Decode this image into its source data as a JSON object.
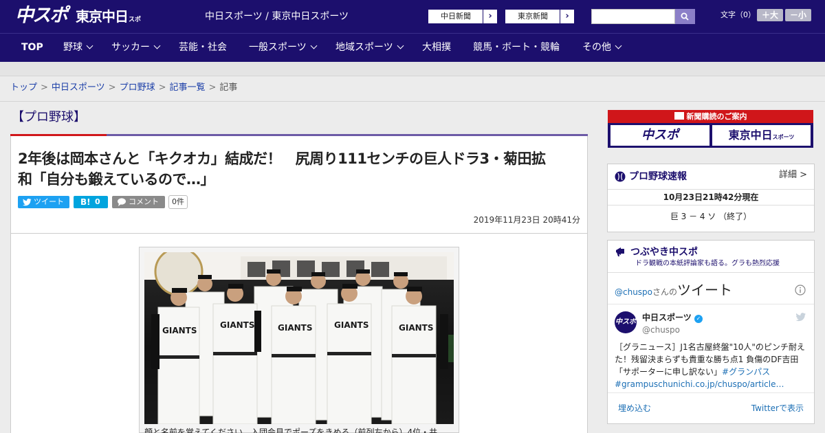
{
  "header": {
    "logo_chuspo": "中スポ",
    "logo_tokyo": "東京中日",
    "logo_tokyo_small": "スポーツ",
    "site_title": "中日スポーツ / 東京中日スポーツ",
    "ext_links": [
      "中日新聞",
      "東京新聞"
    ],
    "search_placeholder": "",
    "font_size_label": "文字（0）",
    "font_plus": "＋大",
    "font_minus": "－小"
  },
  "nav": {
    "items": [
      "TOP",
      "野球",
      "サッカー",
      "芸能・社会",
      "一般スポーツ",
      "地域スポーツ",
      "大相撲",
      "競馬・ボート・競輪",
      "その他"
    ]
  },
  "breadcrumb": {
    "items": [
      "トップ",
      "中日スポーツ",
      "プロ野球",
      "記事一覧",
      "記事"
    ],
    "separator": ">"
  },
  "article": {
    "category": "【プロ野球】",
    "headline_line1": "2年後は岡本さんと「キクオカ」結成だ！　尻周り111センチの巨人ドラ3・菊田拡",
    "headline_line2": "和「自分も鍛えているので…」",
    "tweet_label": "ツイート",
    "hatena_label": "B!",
    "hatena_count": "0",
    "comment_label": "コメント",
    "comment_count": "0件",
    "date": "2019年11月23日 20時41分",
    "photo_caption": "顔と名前を覚えてください。入団会見でポーズをきめる（前列左から）4位・井"
  },
  "sidebar": {
    "promo_title": "新聞購読のご案内",
    "promo_logos": [
      "中スポ",
      "東京中日"
    ],
    "promo_logo_small": "スポーツ",
    "baseball": {
      "title": "プロ野球速報",
      "detail": "詳細 >",
      "timestamp": "10月23日21時42分現在",
      "score": "巨 3 － 4 ソ （終了）"
    },
    "tweets_widget": {
      "title": "つぶやき中スポ",
      "subtitle": "ドラ観戦の本紙評論家も語る。グラも熱烈応援",
      "handle_link": "@chuspo",
      "handle_suffix": "さんの",
      "tweets_label": "ツイート",
      "account_name": "中日スポーツ",
      "account_handle": "@chuspo",
      "avatar_text": "中スポ",
      "tweet_text": "［グラニュース］J1名古屋終盤\"10人\"のピンチ耐えた！残留決まらずも貴重な勝ち点1 負傷のDF吉田「サポーターに申し訳ない」",
      "tweet_tag": "#グランパス",
      "tweet_link": "#grampuschunichi.co.jp/chuspo/article…",
      "embed_label": "埋め込む",
      "view_label": "Twitterで表示"
    }
  },
  "colors": {
    "brand_navy": "#1c0f6d",
    "accent_red": "#d0161a",
    "twitter_blue": "#1da1f2",
    "hatena_blue": "#00a4de",
    "link_blue": "#1c3fa8"
  }
}
